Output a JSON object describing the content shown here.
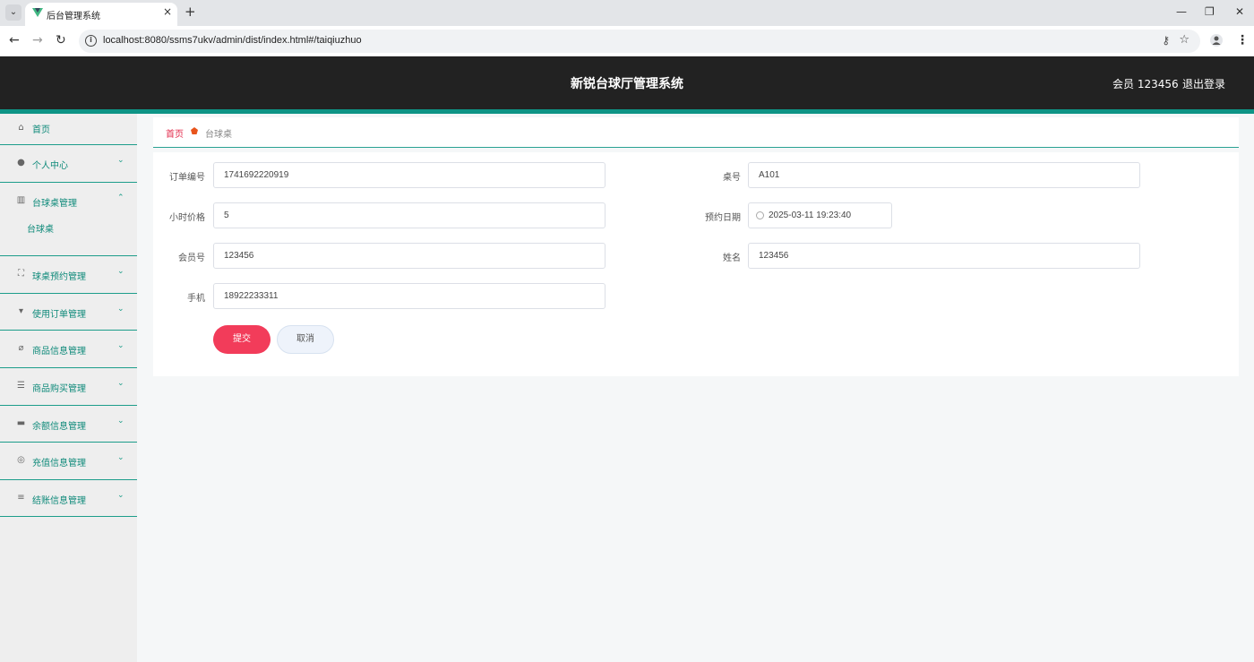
{
  "browser": {
    "tab_title": "后台管理系统",
    "tab_close": "×",
    "new_tab": "+",
    "url": "localhost:8080/ssms7ukv/admin/dist/index.html#/taiqiuzhuo",
    "minimize": "—",
    "restore": "❐",
    "close": "✕",
    "back": "←",
    "forward": "→",
    "reload": "↻",
    "menu": "⋮",
    "key_icon": "⚷",
    "star_icon": "☆",
    "info_icon": "i",
    "tab_switch": "⌄"
  },
  "header": {
    "title": "新锐台球厅管理系统",
    "user": "会员 123456",
    "logout": "退出登录"
  },
  "sidebar": {
    "items": [
      {
        "label": "首页",
        "icon": "home-icon",
        "glyph": "⌂",
        "arrow": ""
      },
      {
        "label": "个人中心",
        "icon": "user-icon",
        "glyph": "●",
        "arrow": "⌄"
      },
      {
        "label": "台球桌管理",
        "icon": "books-icon",
        "glyph": "▥",
        "arrow": "⌃"
      },
      {
        "label": "球桌预约管理",
        "icon": "fullscreen-icon",
        "glyph": "⛶",
        "arrow": "⌄"
      },
      {
        "label": "使用订单管理",
        "icon": "brush-icon",
        "glyph": "▾",
        "arrow": "⌄"
      },
      {
        "label": "商品信息管理",
        "icon": "bell-off-icon",
        "glyph": "⌀",
        "arrow": "⌄"
      },
      {
        "label": "商品购买管理",
        "icon": "list-icon",
        "glyph": "☰",
        "arrow": "⌄"
      },
      {
        "label": "余额信息管理",
        "icon": "ticket-icon",
        "glyph": "▬",
        "arrow": "⌄"
      },
      {
        "label": "充值信息管理",
        "icon": "settings-icon",
        "glyph": "◎",
        "arrow": "⌄"
      },
      {
        "label": "结账信息管理",
        "icon": "sliders-icon",
        "glyph": "≡",
        "arrow": "⌄"
      }
    ],
    "sub_item": "台球桌"
  },
  "breadcrumb": {
    "home": "首页",
    "current": "台球桌"
  },
  "form": {
    "order_no_label": "订单编号",
    "order_no": "1741692220919",
    "table_no_label": "桌号",
    "table_no": "A101",
    "hour_price_label": "小时价格",
    "hour_price": "5",
    "booking_date_label": "预约日期",
    "booking_date": "2025-03-11 19:23:40",
    "member_no_label": "会员号",
    "member_no": "123456",
    "name_label": "姓名",
    "name": "123456",
    "phone_label": "手机",
    "phone": "18922233311",
    "submit": "提交",
    "cancel": "取消"
  },
  "colors": {
    "accent": "#0e9486",
    "submit": "#f23c5a",
    "breadcrumb_home": "#e2294a"
  }
}
